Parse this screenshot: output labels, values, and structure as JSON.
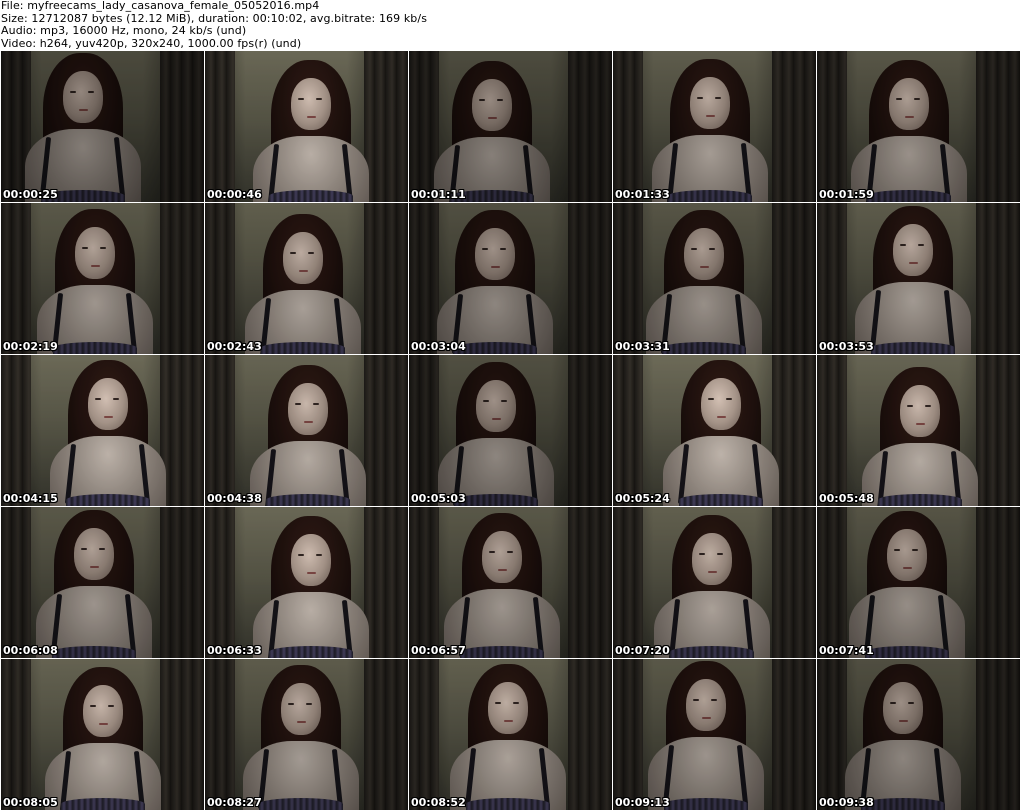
{
  "header": {
    "file_line": "File: myfreecams_lady_casanova_female_05052016.mp4",
    "size_line": "Size: 12712087 bytes (12.12 MiB), duration: 00:10:02, avg.bitrate: 169 kb/s",
    "audio_line": "Audio: mp3, 16000 Hz, mono, 24 kb/s (und)",
    "video_line": "Video: h264, yuv420p, 320x240, 1000.00 fps(r) (und)"
  },
  "thumbnails": [
    {
      "timestamp": "00:00:25"
    },
    {
      "timestamp": "00:00:46"
    },
    {
      "timestamp": "00:01:11"
    },
    {
      "timestamp": "00:01:33"
    },
    {
      "timestamp": "00:01:59"
    },
    {
      "timestamp": "00:02:19"
    },
    {
      "timestamp": "00:02:43"
    },
    {
      "timestamp": "00:03:04"
    },
    {
      "timestamp": "00:03:31"
    },
    {
      "timestamp": "00:03:53"
    },
    {
      "timestamp": "00:04:15"
    },
    {
      "timestamp": "00:04:38"
    },
    {
      "timestamp": "00:05:03"
    },
    {
      "timestamp": "00:05:24"
    },
    {
      "timestamp": "00:05:48"
    },
    {
      "timestamp": "00:06:08"
    },
    {
      "timestamp": "00:06:33"
    },
    {
      "timestamp": "00:06:57"
    },
    {
      "timestamp": "00:07:20"
    },
    {
      "timestamp": "00:07:41"
    },
    {
      "timestamp": "00:08:05"
    },
    {
      "timestamp": "00:08:27"
    },
    {
      "timestamp": "00:08:52"
    },
    {
      "timestamp": "00:09:13"
    },
    {
      "timestamp": "00:09:38"
    }
  ],
  "colors": {
    "background": "#ffffff",
    "header_text": "#000000",
    "timestamp_text": "#ffffff",
    "timestamp_outline": "#000000"
  }
}
